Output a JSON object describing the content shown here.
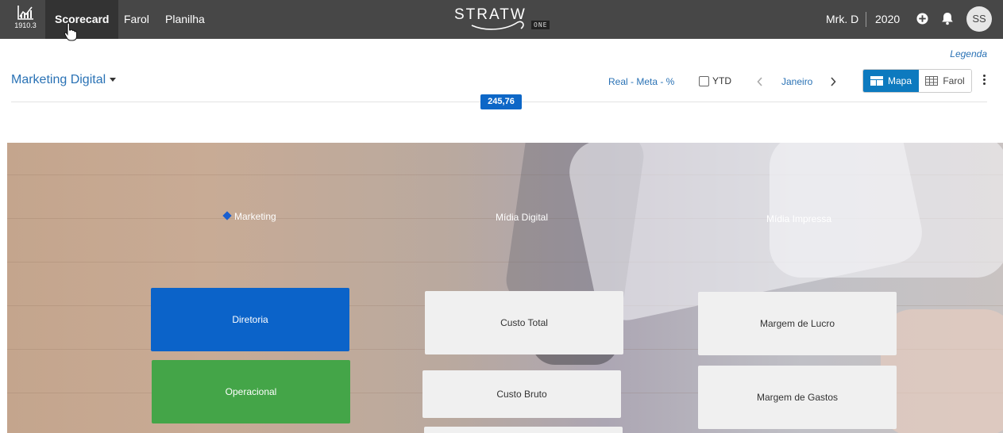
{
  "topbar": {
    "logo_number": "1910.3",
    "tabs": [
      {
        "label": "Scorecard",
        "active": true
      },
      {
        "label": "Farol",
        "active": false
      },
      {
        "label": "Planilha",
        "active": false
      }
    ],
    "brand_text": "STRATW",
    "brand_suffix": "ONE",
    "user_name": "Mrk. D",
    "year": "2020",
    "avatar_initials": "SS"
  },
  "subheader": {
    "legend_link": "Legenda",
    "page_title": "Marketing Digital",
    "filter_mode": "Real - Meta - %",
    "ytd_label": "YTD",
    "ytd_checked": false,
    "month": "Janeiro",
    "view_options": [
      {
        "label": "Mapa",
        "selected": true
      },
      {
        "label": "Farol",
        "selected": false
      }
    ],
    "score_badge": "245,76"
  },
  "map": {
    "perspectives": [
      {
        "label": "Marketing",
        "selected": true
      },
      {
        "label": "Mídia Digital"
      },
      {
        "label": "Mídia Impressa"
      }
    ],
    "objectives": [
      {
        "label": "Diretoria",
        "color": "#0b63c9"
      },
      {
        "label": "Operacional",
        "color": "#44a548"
      },
      {
        "label": "Custo Total"
      },
      {
        "label": "Custo Bruto"
      },
      {
        "label": "Margem de Lucro"
      },
      {
        "label": "Margem de Gastos"
      }
    ]
  },
  "colors": {
    "topbar_bg": "#474747",
    "accent_blue": "#2a72b5",
    "toggle_active": "#0d7abf"
  }
}
